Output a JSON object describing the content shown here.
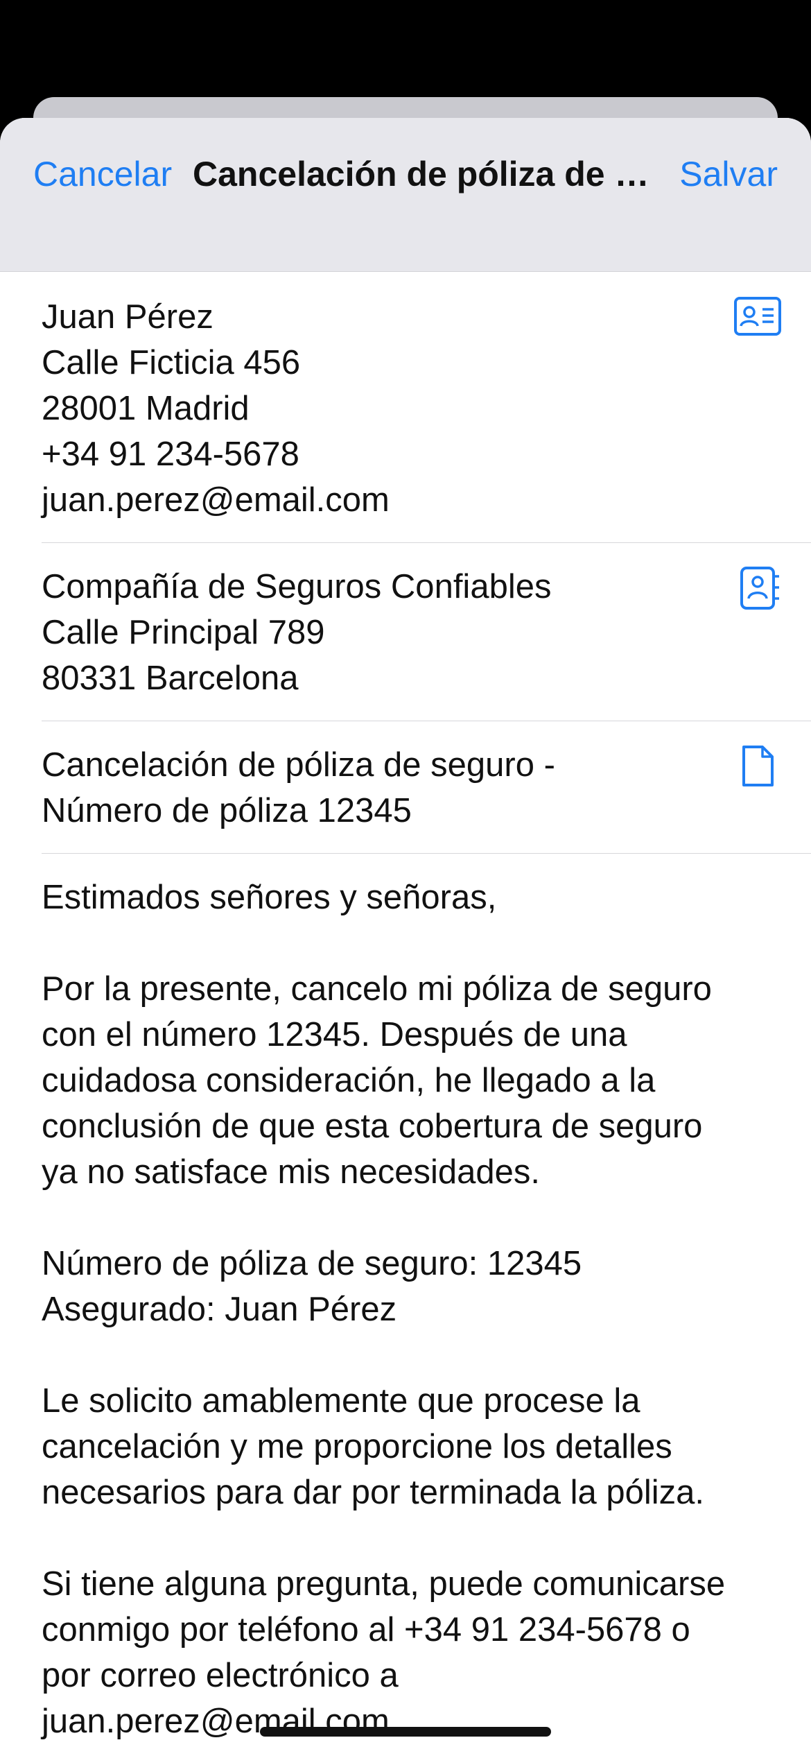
{
  "nav": {
    "cancel_label": "Cancelar",
    "title": "Cancelación de póliza de s...",
    "save_label": "Salvar"
  },
  "sender": {
    "lines": [
      "Juan Pérez",
      "Calle Ficticia 456",
      "28001 Madrid",
      "+34 91 234-5678",
      "juan.perez@email.com"
    ],
    "icon": "contact-card-icon"
  },
  "recipient": {
    "lines": [
      "Compañía de Seguros Confiables",
      "Calle Principal 789",
      "80331 Barcelona"
    ],
    "icon": "address-book-icon"
  },
  "subject": {
    "lines": [
      "Cancelación de póliza de seguro -",
      "Número de póliza 12345"
    ],
    "icon": "document-icon"
  },
  "body": {
    "text": "Estimados señores y señoras,\n\nPor la presente, cancelo mi póliza de seguro\ncon el número 12345. Después de una\ncuidadosa consideración, he llegado a la\nconclusión de que esta cobertura de seguro\nya no satisface mis necesidades.\n\nNúmero de póliza de seguro: 12345\nAsegurado: Juan Pérez\n\nLe solicito amablemente que procese la\ncancelación y me proporcione los detalles\nnecesarios para dar por terminada la póliza.\n\nSi tiene alguna pregunta, puede comunicarse\nconmigo por teléfono al +34 91 234-5678 o\npor correo electrónico a\njuan.perez@email.com."
  },
  "colors": {
    "accent": "#1f7ef3",
    "nav_background": "#e7e7ec"
  }
}
